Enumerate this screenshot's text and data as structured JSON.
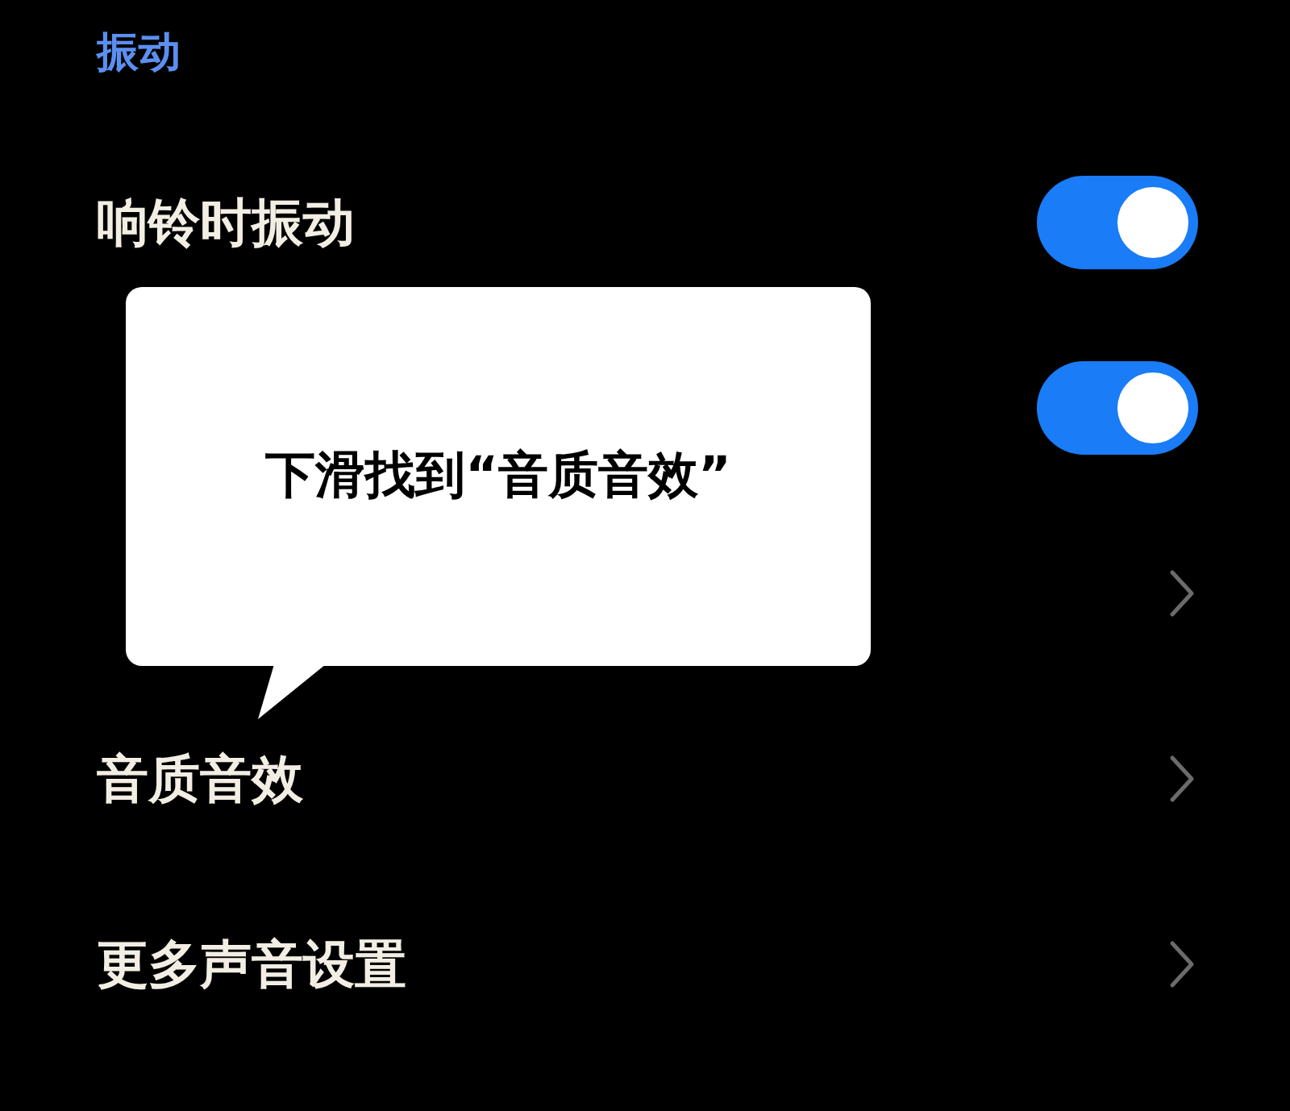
{
  "section_title": "振动",
  "rows": [
    {
      "kind": "toggle",
      "label": "响铃时振动",
      "on": true
    },
    {
      "kind": "toggle",
      "on": true
    },
    {
      "kind": "link"
    },
    {
      "kind": "link",
      "label": "音质音效"
    },
    {
      "kind": "link",
      "label": "更多声音设置"
    }
  ],
  "tooltip": {
    "text": "下滑找到“音质音效”"
  }
}
